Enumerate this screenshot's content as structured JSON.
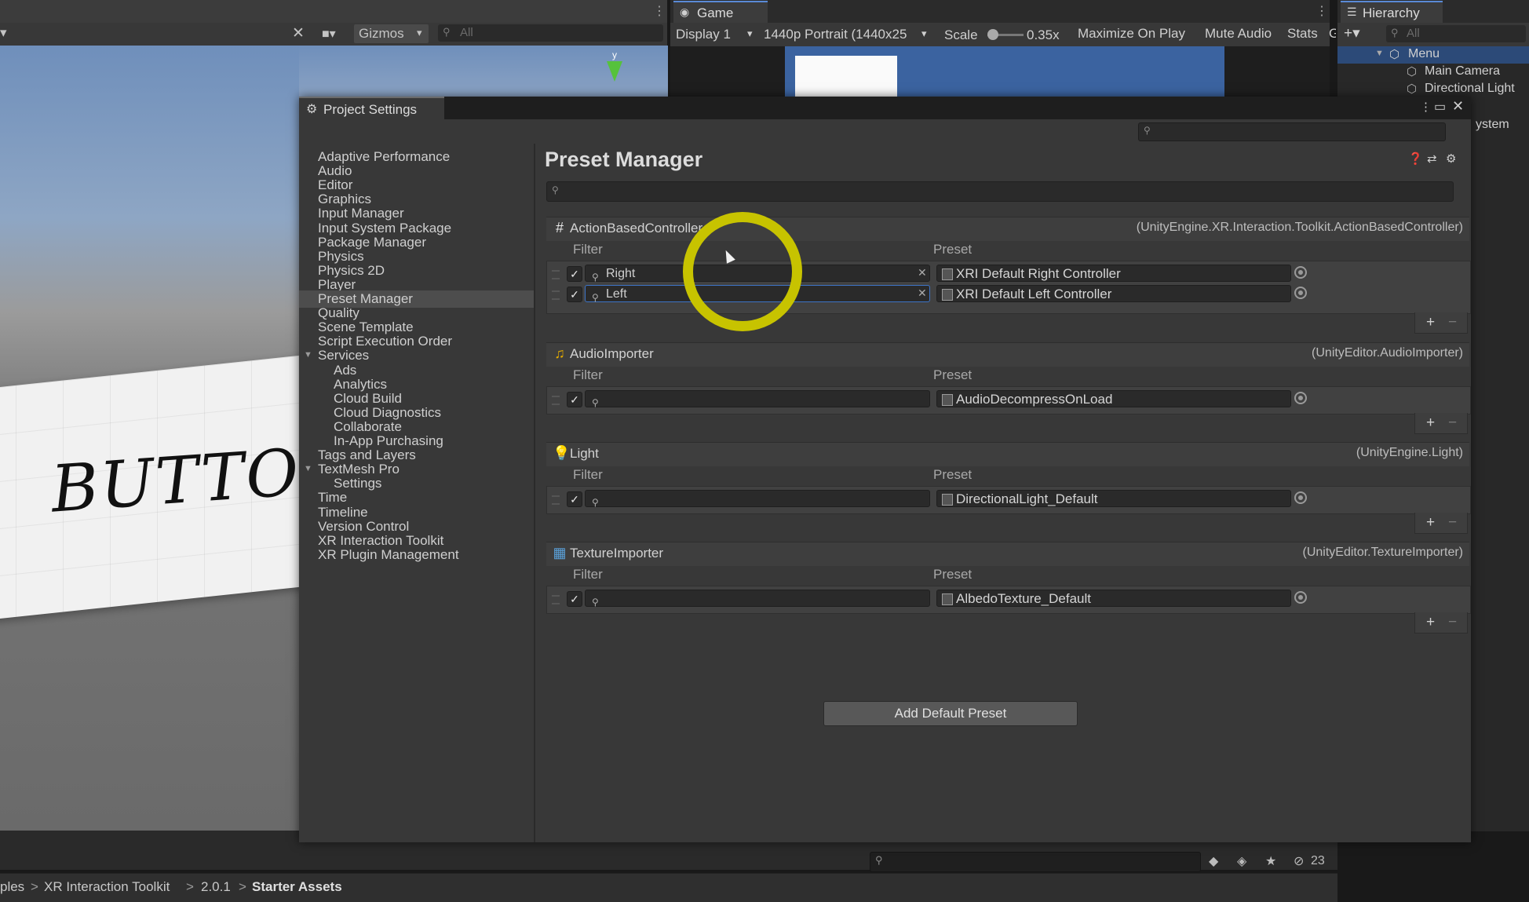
{
  "scene_toolbar": {
    "gizmos_label": "Gizmos",
    "search_placeholder": "All"
  },
  "scene_view": {
    "button_text": "BUTTON"
  },
  "game": {
    "tab_label": "Game",
    "display_label": "Display 1",
    "resolution_label": "1440p Portrait (1440x25",
    "scale_label": "Scale",
    "scale_value": "0.35x",
    "maximize_label": "Maximize On Play",
    "mute_label": "Mute Audio",
    "stats_label": "Stats",
    "gizmo_clip": "G"
  },
  "hierarchy": {
    "tab_label": "Hierarchy",
    "search_placeholder": "All",
    "items": [
      "Menu",
      "Main Camera",
      "Directional Light",
      "ystem"
    ]
  },
  "project_settings": {
    "title": "Project Settings",
    "nav": [
      "Adaptive Performance",
      "Audio",
      "Editor",
      "Graphics",
      "Input Manager",
      "Input System Package",
      "Package Manager",
      "Physics",
      "Physics 2D",
      "Player",
      "Preset Manager",
      "Quality",
      "Scene Template",
      "Script Execution Order",
      "Services",
      "Ads",
      "Analytics",
      "Cloud Build",
      "Cloud Diagnostics",
      "Collaborate",
      "In-App Purchasing",
      "Tags and Layers",
      "TextMesh Pro",
      "Settings",
      "Time",
      "Timeline",
      "Version Control",
      "XR Interaction Toolkit",
      "XR Plugin Management"
    ],
    "selected_nav": "Preset Manager",
    "content_title": "Preset Manager",
    "filter_header": "Filter",
    "preset_header": "Preset",
    "add_default_preset": "Add Default Preset",
    "sections": [
      {
        "name": "ActionBasedController",
        "type": "(UnityEngine.XR.Interaction.Toolkit.ActionBasedController)",
        "icon": "script-icon",
        "rows": [
          {
            "filter": "Right",
            "preset": "XRI Default Right Controller",
            "checked": true
          },
          {
            "filter": "Left",
            "preset": "XRI Default Left Controller",
            "checked": true
          }
        ]
      },
      {
        "name": "AudioImporter",
        "type": "(UnityEditor.AudioImporter)",
        "icon": "audio-icon",
        "rows": [
          {
            "filter": "",
            "preset": "AudioDecompressOnLoad",
            "checked": true
          }
        ]
      },
      {
        "name": "Light",
        "type": "(UnityEngine.Light)",
        "icon": "light-bulb-icon",
        "rows": [
          {
            "filter": "",
            "preset": "DirectionalLight_Default",
            "checked": true
          }
        ]
      },
      {
        "name": "TextureImporter",
        "type": "(UnityEditor.TextureImporter)",
        "icon": "texture-icon",
        "rows": [
          {
            "filter": "",
            "preset": "AlbedoTexture_Default",
            "checked": true
          }
        ]
      }
    ]
  },
  "bottom": {
    "breadcrumbs": [
      "ples",
      "XR Interaction Toolkit",
      "2.0.1",
      "Starter Assets"
    ],
    "hidden_count": "23"
  },
  "colors": {
    "accent": "#3d74c7",
    "highlight_ring": "#c7c300",
    "selection": "#4d4d4d"
  }
}
